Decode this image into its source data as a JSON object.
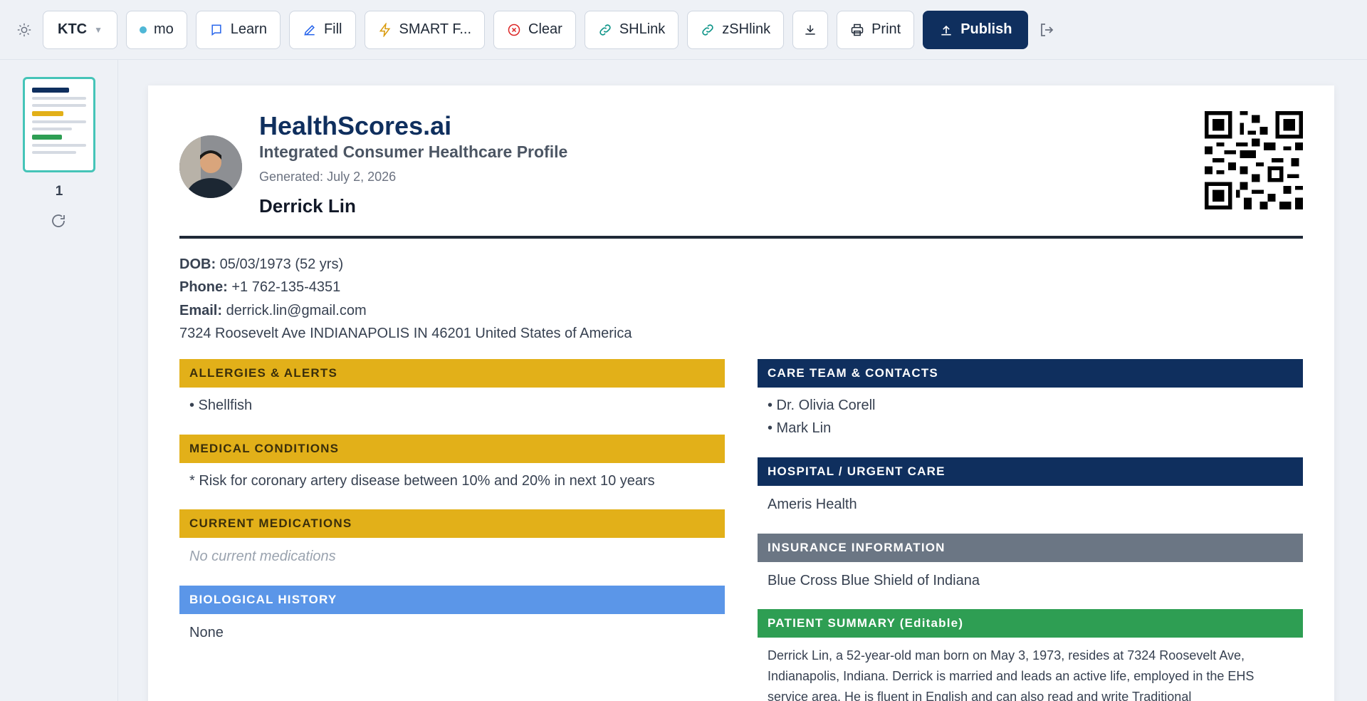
{
  "toolbar": {
    "profile_label": "KTC",
    "mode_label": "mo",
    "learn_label": "Learn",
    "fill_label": "Fill",
    "smart_label": "SMART F...",
    "clear_label": "Clear",
    "shlink_label": "SHLink",
    "zshlink_label": "zSHlink",
    "print_label": "Print",
    "publish_label": "Publish"
  },
  "sidebar": {
    "page_number": "1"
  },
  "profile": {
    "brand": "HealthScores.ai",
    "subtitle": "Integrated Consumer Healthcare Profile",
    "generated": "Generated: July 2, 2026",
    "name": "Derrick Lin",
    "dob_label": "DOB:",
    "dob": "05/03/1973 (52 yrs)",
    "phone_label": "Phone:",
    "phone": "+1 762-135-4351",
    "email_label": "Email:",
    "email": "derrick.lin@gmail.com",
    "address": "7324 Roosevelt Ave INDIANAPOLIS IN 46201 United States of America"
  },
  "sections": {
    "allergies": {
      "title": "ALLERGIES & ALERTS",
      "items": [
        "• Shellfish"
      ]
    },
    "conditions": {
      "title": "MEDICAL CONDITIONS",
      "items": [
        "* Risk for coronary artery disease between 10% and 20% in next 10 years"
      ]
    },
    "medications": {
      "title": "CURRENT MEDICATIONS",
      "empty": "No current medications"
    },
    "bio_history": {
      "title": "BIOLOGICAL HISTORY",
      "value": "None"
    },
    "care_team": {
      "title": "CARE TEAM & CONTACTS",
      "items": [
        "• Dr. Olivia Corell",
        "• Mark Lin"
      ]
    },
    "hospital": {
      "title": "HOSPITAL / URGENT CARE",
      "value": "Ameris Health"
    },
    "insurance": {
      "title": "INSURANCE INFORMATION",
      "value": "Blue Cross Blue Shield of Indiana"
    },
    "summary": {
      "title": "PATIENT SUMMARY (Editable)",
      "text": "Derrick Lin, a 52-year-old man born on May 3, 1973, resides at 7324 Roosevelt Ave, Indianapolis, Indiana. Derrick is married and leads an active life, employed in the EHS service area. He is fluent in English and can also read and write Traditional"
    }
  },
  "colors": {
    "navy": "#0f2f5e",
    "gold": "#e2b019",
    "blue": "#5b96e8",
    "gray": "#6b7684",
    "green": "#2e9e53",
    "thumb_border": "#45c4b8"
  }
}
